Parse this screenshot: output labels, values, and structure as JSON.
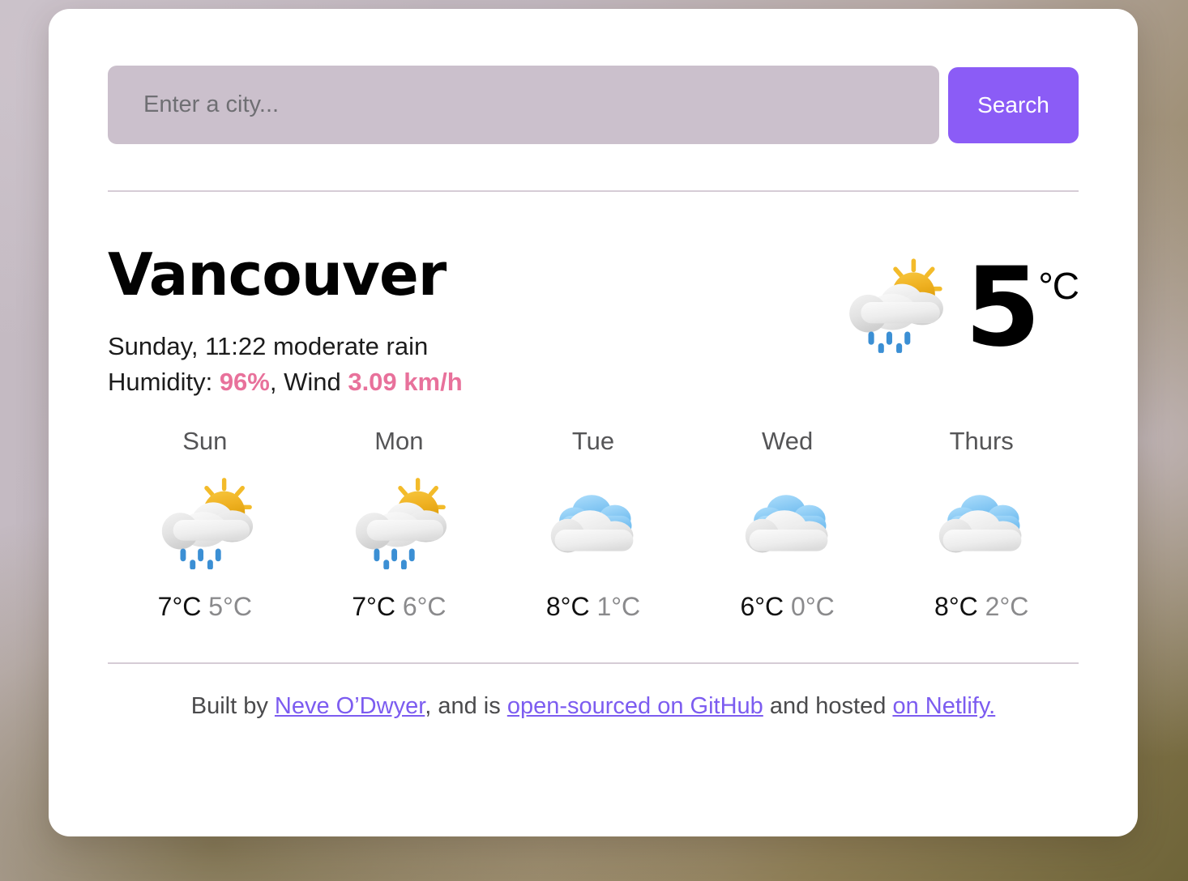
{
  "search": {
    "placeholder": "Enter a city...",
    "value": "",
    "button_label": "Search"
  },
  "current": {
    "city": "Vancouver",
    "datetime_description": "Sunday, 11:22 moderate rain",
    "humidity_label": "Humidity: ",
    "humidity_value": "96%",
    "wind_label": ", Wind ",
    "wind_value": "3.09 km/h",
    "temperature": "5",
    "unit": "°C",
    "icon": "sun-behind-rain-cloud-icon"
  },
  "forecast": [
    {
      "day": "Sun",
      "icon": "sun-behind-rain-cloud-icon",
      "max": "7°C",
      "min": "5°C"
    },
    {
      "day": "Mon",
      "icon": "sun-behind-rain-cloud-icon",
      "max": "7°C",
      "min": "6°C"
    },
    {
      "day": "Tue",
      "icon": "broken-clouds-icon",
      "max": "8°C",
      "min": "1°C"
    },
    {
      "day": "Wed",
      "icon": "broken-clouds-icon",
      "max": "6°C",
      "min": "0°C"
    },
    {
      "day": "Thurs",
      "icon": "broken-clouds-icon",
      "max": "8°C",
      "min": "2°C"
    }
  ],
  "footer": {
    "prefix": "Built by ",
    "author_link": "Neve O’Dwyer",
    "middle": ", and is ",
    "source_link": "open-sourced on GitHub",
    "middle2": " and hosted ",
    "host_link": "on Netlify.",
    "suffix": ""
  },
  "colors": {
    "accent_purple": "#8b5cf6",
    "highlight_pink": "#e8719b",
    "input_bg": "#cbc0cc",
    "divider": "#d6ccd6",
    "sun_amber": "#efb122",
    "rain_blue": "#3b8fd4",
    "cloud_blue": "#7fc4f2"
  }
}
